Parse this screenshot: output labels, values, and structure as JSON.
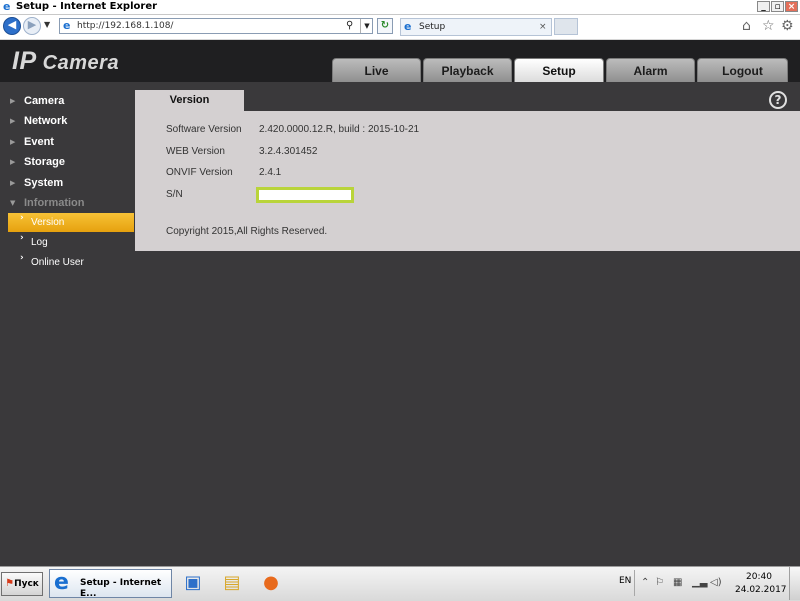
{
  "browser": {
    "window_title": "Setup - Internet Explorer",
    "url": "http://192.168.1.108/",
    "tab_title": "Setup",
    "tab_close": "×",
    "winbtn_min": "_",
    "winbtn_max": "▫",
    "winbtn_close": "×"
  },
  "app": {
    "logo_main": "IP",
    "logo_sub": " Camera",
    "nav": [
      {
        "label": "Live"
      },
      {
        "label": "Playback"
      },
      {
        "label": "Setup"
      },
      {
        "label": "Alarm"
      },
      {
        "label": "Logout"
      }
    ],
    "active_nav": "Setup"
  },
  "sidebar": {
    "items": [
      {
        "label": "Camera"
      },
      {
        "label": "Network"
      },
      {
        "label": "Event"
      },
      {
        "label": "Storage"
      },
      {
        "label": "System"
      },
      {
        "label": "Information"
      }
    ],
    "sub_items": [
      {
        "label": "Version"
      },
      {
        "label": "Log"
      },
      {
        "label": "Online User"
      }
    ],
    "active_sub": "Version"
  },
  "content": {
    "tab_title": "Version",
    "help": "?",
    "rows": [
      {
        "label": "Software Version",
        "value": "2.420.0000.12.R, build : 2015-10-21"
      },
      {
        "label": "WEB Version",
        "value": "3.2.4.301452"
      },
      {
        "label": "ONVIF Version",
        "value": "2.4.1"
      },
      {
        "label": "S/N",
        "value": ""
      }
    ],
    "copyright": "Copyright 2015,All Rights Reserved."
  },
  "taskbar": {
    "start_label": "Пуск",
    "ie_task_label": "Setup - Internet E...",
    "language": "EN",
    "time": "20:40",
    "date": "24.02.2017"
  },
  "colors": {
    "header_bg": "#1f1f21",
    "page_bg": "#3a393b",
    "panel_bg": "#d4d0d1",
    "active_sub_bg": "#f0b323",
    "sn_border": "#b9d43a"
  }
}
